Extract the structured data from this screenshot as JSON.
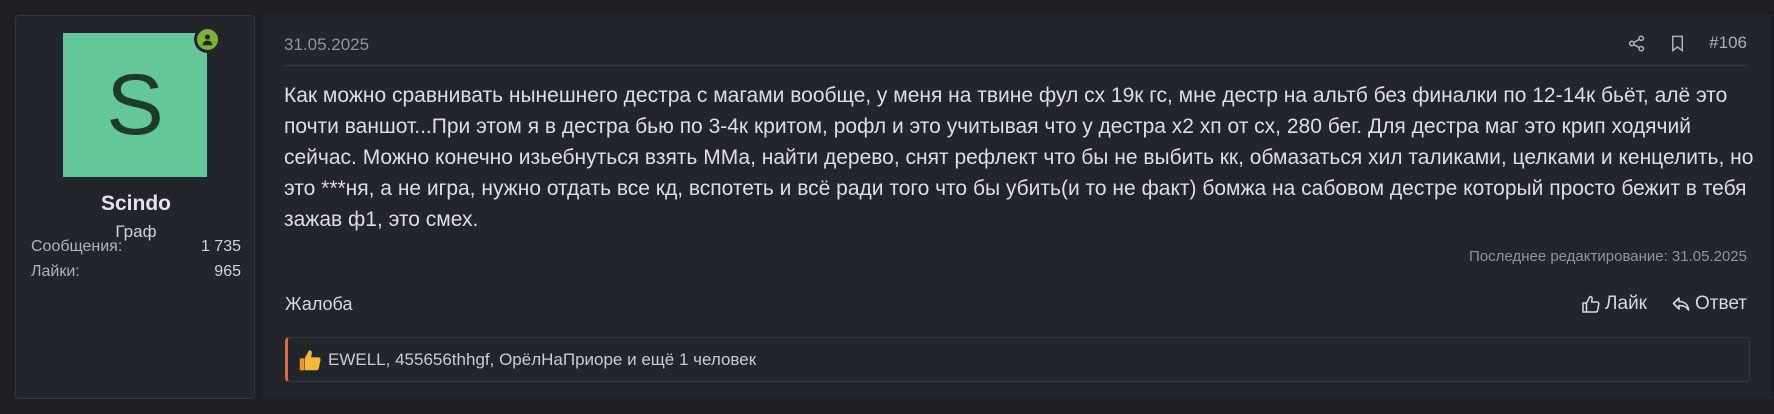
{
  "author": {
    "avatar_letter": "S",
    "username": "Scindo",
    "title": "Граф",
    "stats": [
      {
        "label": "Сообщения:",
        "value": "1 735"
      },
      {
        "label": "Лайки:",
        "value": "965"
      }
    ],
    "online": true
  },
  "post": {
    "date": "31.05.2025",
    "number": "#106",
    "body": "Как можно сравнивать нынешнего дестра с магами вообще, у меня на твине фул сх 19к гс, мне дестр на альтб без финалки по 12-14к бьёт, алё это почти ваншот...При этом я в дестра бью по 3-4к критом, рофл и это учитывая что у дестра х2 хп от сх, 280 бег. Для дестра маг это крип ходячий сейчас. Можно конечно изьебнуться взять ММа, найти дерево, снят рефлект что бы не выбить кк, обмазаться хил таликами, целками и кенцелить, но это ***ня, а не игра, нужно отдать все кд, вспотеть и всё ради того что бы убить(и то не факт) бомжа на сабовом дестре который просто бежит в тебя зажав ф1, это смех.",
    "last_edit": "Последнее редактирование: 31.05.2025",
    "report_label": "Жалоба",
    "like_label": "Лайк",
    "reply_label": "Ответ",
    "reactions_text": "EWELL, 455656thhgf, ОрёлНаПриоре и ещё 1 человек"
  },
  "icons": {
    "share": "share-icon",
    "bookmark": "bookmark-icon",
    "like": "thumbs-up-icon",
    "reply": "reply-icon",
    "reaction": "thumbs-up-reaction-icon",
    "online": "user-online-icon"
  },
  "colors": {
    "background": "#1e1f25",
    "panel": "#23252c",
    "avatar": "#64c79a",
    "online": "#7bb03b",
    "reaction_accent": "#d96b3f",
    "like_icon": "#f5b63a"
  }
}
